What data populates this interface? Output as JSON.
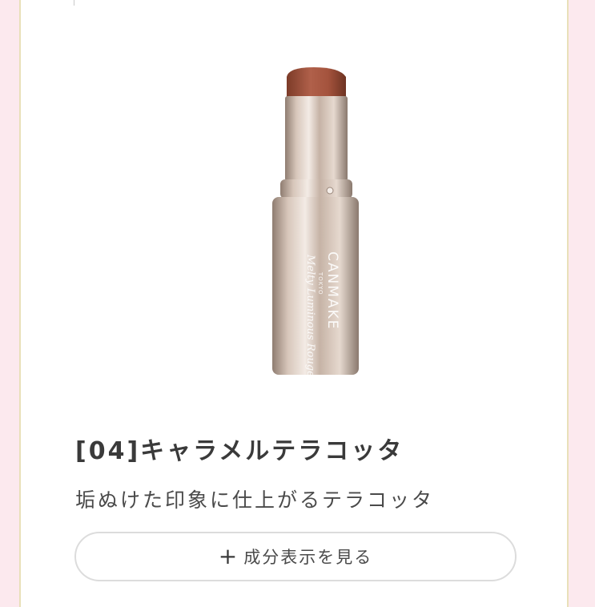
{
  "product": {
    "title": "[04]キャラメルテラコッタ",
    "description": "垢ぬけた印象に仕上がるテラコッタ",
    "image_brand_text": "CANMAKE",
    "image_brand_sub": "TOKYO",
    "image_product_text": "Melty Luminous Rouge"
  },
  "ingredients_button": {
    "icon": "plus-icon",
    "label": "成分表示を見る"
  },
  "colors": {
    "background": "#fce9ee",
    "card_border": "#e9e0b9",
    "lipstick": "#a8553e",
    "case": "#c9b3a4"
  }
}
